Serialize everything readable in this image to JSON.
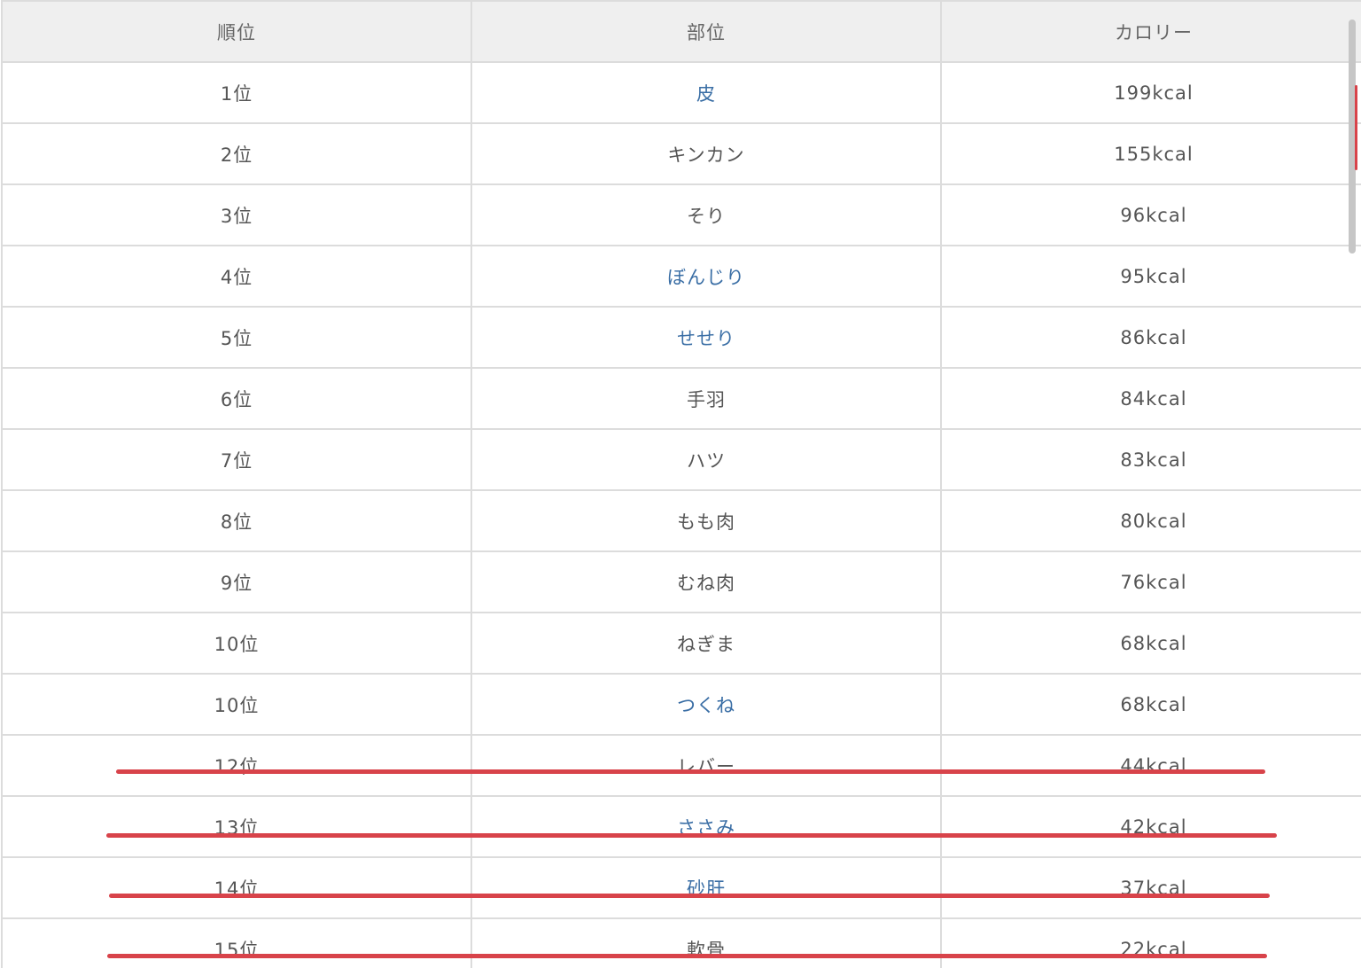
{
  "table": {
    "headers": [
      "順位",
      "部位",
      "カロリー"
    ],
    "rows": [
      {
        "rank": "1位",
        "part": "皮",
        "kcal": "199kcal",
        "linked": true
      },
      {
        "rank": "2位",
        "part": "キンカン",
        "kcal": "155kcal",
        "linked": false
      },
      {
        "rank": "3位",
        "part": "そり",
        "kcal": "96kcal",
        "linked": false
      },
      {
        "rank": "4位",
        "part": "ぼんじり",
        "kcal": "95kcal",
        "linked": true
      },
      {
        "rank": "5位",
        "part": "せせり",
        "kcal": "86kcal",
        "linked": true
      },
      {
        "rank": "6位",
        "part": "手羽",
        "kcal": "84kcal",
        "linked": false
      },
      {
        "rank": "7位",
        "part": "ハツ",
        "kcal": "83kcal",
        "linked": false
      },
      {
        "rank": "8位",
        "part": "もも肉",
        "kcal": "80kcal",
        "linked": false
      },
      {
        "rank": "9位",
        "part": "むね肉",
        "kcal": "76kcal",
        "linked": false
      },
      {
        "rank": "10位",
        "part": "ねぎま",
        "kcal": "68kcal",
        "linked": false
      },
      {
        "rank": "10位",
        "part": "つくね",
        "kcal": "68kcal",
        "linked": true
      },
      {
        "rank": "12位",
        "part": "レバー",
        "kcal": "44kcal",
        "linked": false
      },
      {
        "rank": "13位",
        "part": "ささみ",
        "kcal": "42kcal",
        "linked": true
      },
      {
        "rank": "14位",
        "part": "砂肝",
        "kcal": "37kcal",
        "linked": true
      },
      {
        "rank": "15位",
        "part": "軟骨",
        "kcal": "22kcal",
        "linked": false
      }
    ]
  },
  "colors": {
    "link": "#3a6ea5",
    "highlight": "#d8434a",
    "header_bg": "#efefef"
  }
}
